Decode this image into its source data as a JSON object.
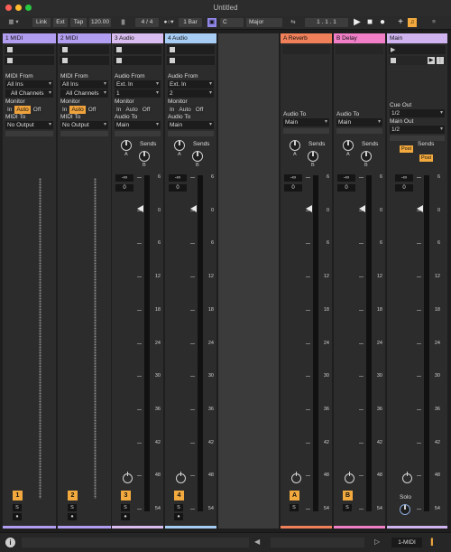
{
  "window": {
    "title": "Untitled"
  },
  "control_bar": {
    "link": "Link",
    "ext": "Ext",
    "tap": "Tap",
    "tempo": "120.00",
    "signature": "4 / 4",
    "quantize": "1 Bar",
    "key": "C",
    "scale": "Major",
    "position": "1 .  1 .  1"
  },
  "tracks": [
    {
      "name": "1 MIDI",
      "color": "#b29ef0",
      "kind": "midi",
      "from_label": "MIDI From",
      "from_value": "All Ins",
      "channel": "All Channels",
      "monitor_label": "Monitor",
      "to_label": "MIDI To",
      "to_value": "No Output",
      "number": "1"
    },
    {
      "name": "2 MIDI",
      "color": "#b29ef0",
      "kind": "midi",
      "from_label": "MIDI From",
      "from_value": "All Ins",
      "channel": "All Channels",
      "monitor_label": "Monitor",
      "to_label": "MIDI To",
      "to_value": "No Output",
      "number": "2"
    },
    {
      "name": "3 Audio",
      "color": "#d9bdf0",
      "kind": "audio",
      "from_label": "Audio From",
      "from_value": "Ext. In",
      "channel": "1",
      "monitor_label": "Monitor",
      "to_label": "Audio To",
      "to_value": "Main",
      "number": "3"
    },
    {
      "name": "4 Audio",
      "color": "#a7cdf5",
      "kind": "audio",
      "from_label": "Audio From",
      "from_value": "Ext. In",
      "channel": "2",
      "monitor_label": "Monitor",
      "to_label": "Audio To",
      "to_value": "Main",
      "number": "4"
    },
    {
      "name": "A Reverb",
      "color": "#f0805a",
      "kind": "return",
      "to_label": "Audio To",
      "to_value": "Main",
      "number": "A"
    },
    {
      "name": "B Delay",
      "color": "#f07fc7",
      "kind": "return",
      "to_label": "Audio To",
      "to_value": "Main",
      "number": "B"
    },
    {
      "name": "Main",
      "color": "#d0b4f0",
      "kind": "main",
      "cue_label": "Cue Out",
      "cue_value": "1/2",
      "main_label": "Main Out",
      "main_value": "1/2",
      "post_label": "Post",
      "solo_label": "Solo"
    }
  ],
  "monitor_options": [
    "In",
    "Auto",
    "Off"
  ],
  "sends_label": "Sends",
  "send_labels": [
    "A",
    "B"
  ],
  "volume_readout": "-∞",
  "volume_sub": "0",
  "solo_letter": "S",
  "meter_scale": [
    "6",
    "0",
    "6",
    "12",
    "18",
    "24",
    "30",
    "36",
    "42",
    "48",
    "54",
    "60"
  ],
  "status_bar": {
    "track_label": "1-MIDI"
  },
  "colors": {
    "accent": "#f2a93e"
  }
}
